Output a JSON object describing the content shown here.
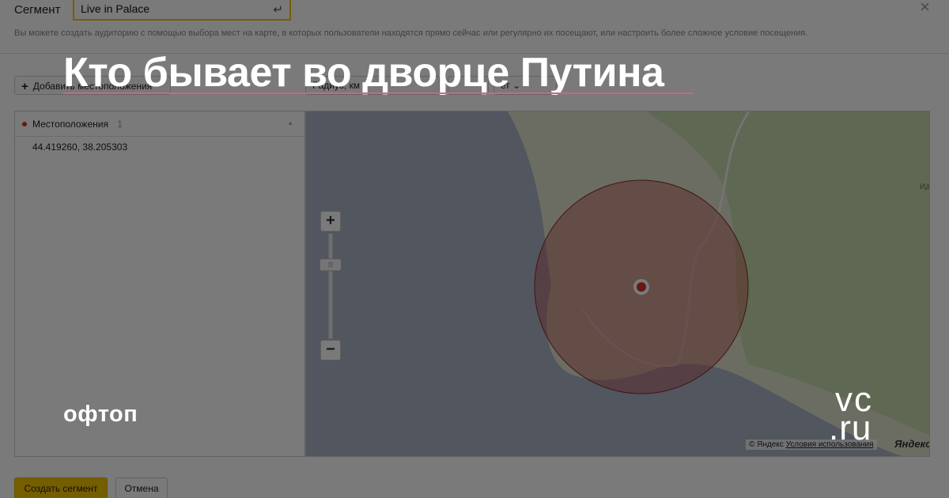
{
  "segment": {
    "label": "Сегмент",
    "name_value": "Live in Palace",
    "hint": "Вы можете создать аудиторию с помощью выбора мест на карте, в которых пользователи находятся прямо сейчас или регулярно их посещают, или настроить более сложное условие посещения."
  },
  "toolbar": {
    "add_location": "Добавить местоположения",
    "radius": "Радиус, км",
    "setting": "ет"
  },
  "locations_panel": {
    "title": "Местоположения",
    "count": "1",
    "items": [
      "44.419260, 38.205303"
    ]
  },
  "map": {
    "side_label": "Ид",
    "copyright_prefix": "© Яндекс",
    "terms_link": "Условия использования",
    "provider_logo": "Яндекс",
    "circle_color": "#c0504d",
    "marker_color": "#d8322c",
    "sea_color": "#aab4c7",
    "land_color": "#e6ebd7",
    "green_color": "#c5d9ac"
  },
  "footer": {
    "create_label": "Создать сегмент",
    "cancel_label": "Отмена"
  },
  "overlay": {
    "headline": "Кто бывает во дворце Путина",
    "tag": "офтоп",
    "logo_top": "vc",
    "logo_bottom": ".ru"
  }
}
